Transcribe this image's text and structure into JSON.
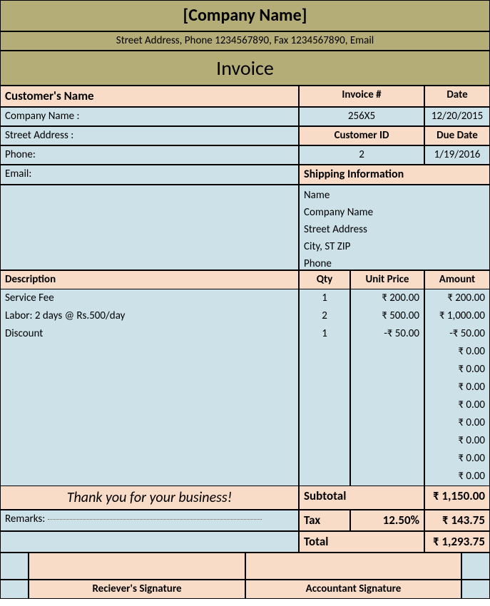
{
  "header": {
    "company_name": "[Company Name]",
    "address_line": "Street Address, Phone 1234567890, Fax 1234567890, Email",
    "invoice_title": "Invoice"
  },
  "customer": {
    "section_label": "Customer's Name",
    "company_label": "Company Name :",
    "street_label": "Street Address :",
    "phone_label": "Phone:",
    "email_label": "Email:"
  },
  "meta": {
    "invoice_no_label": "Invoice #",
    "invoice_no": "256X5",
    "date_label": "Date",
    "date": "12/20/2015",
    "customer_id_label": "Customer ID",
    "customer_id": "2",
    "due_date_label": "Due Date",
    "due_date": "1/19/2016"
  },
  "shipping": {
    "label": "Shipping Information",
    "name": "Name",
    "company": "Company Name",
    "street": "Street Address",
    "city": "City, ST ZIP",
    "phone": "Phone"
  },
  "columns": {
    "description": "Description",
    "qty": "Qty",
    "unit_price": "Unit Price",
    "amount": "Amount"
  },
  "items": [
    {
      "desc": "Service Fee",
      "qty": "1",
      "price": "₹ 200.00",
      "amount": "₹ 200.00"
    },
    {
      "desc": "Labor: 2 days @ Rs.500/day",
      "qty": "2",
      "price": "₹ 500.00",
      "amount": "₹ 1,000.00"
    },
    {
      "desc": "Discount",
      "qty": "1",
      "price": "-₹ 50.00",
      "amount": "-₹ 50.00"
    },
    {
      "desc": "",
      "qty": "",
      "price": "",
      "amount": "₹ 0.00"
    },
    {
      "desc": "",
      "qty": "",
      "price": "",
      "amount": "₹ 0.00"
    },
    {
      "desc": "",
      "qty": "",
      "price": "",
      "amount": "₹ 0.00"
    },
    {
      "desc": "",
      "qty": "",
      "price": "",
      "amount": "₹ 0.00"
    },
    {
      "desc": "",
      "qty": "",
      "price": "",
      "amount": "₹ 0.00"
    },
    {
      "desc": "",
      "qty": "",
      "price": "",
      "amount": "₹ 0.00"
    },
    {
      "desc": "",
      "qty": "",
      "price": "",
      "amount": "₹ 0.00"
    },
    {
      "desc": "",
      "qty": "",
      "price": "",
      "amount": "₹ 0.00"
    }
  ],
  "footer": {
    "thankyou": "Thank you for your business!",
    "remarks_label": "Remarks:",
    "subtotal_label": "Subtotal",
    "subtotal": "₹ 1,150.00",
    "tax_label": "Tax",
    "tax_rate": "12.50%",
    "tax_amount": "₹ 143.75",
    "total_label": "Total",
    "total": "₹ 1,293.75",
    "receiver_sig": "Reciever's Signature",
    "accountant_sig": "Accountant Signature"
  }
}
